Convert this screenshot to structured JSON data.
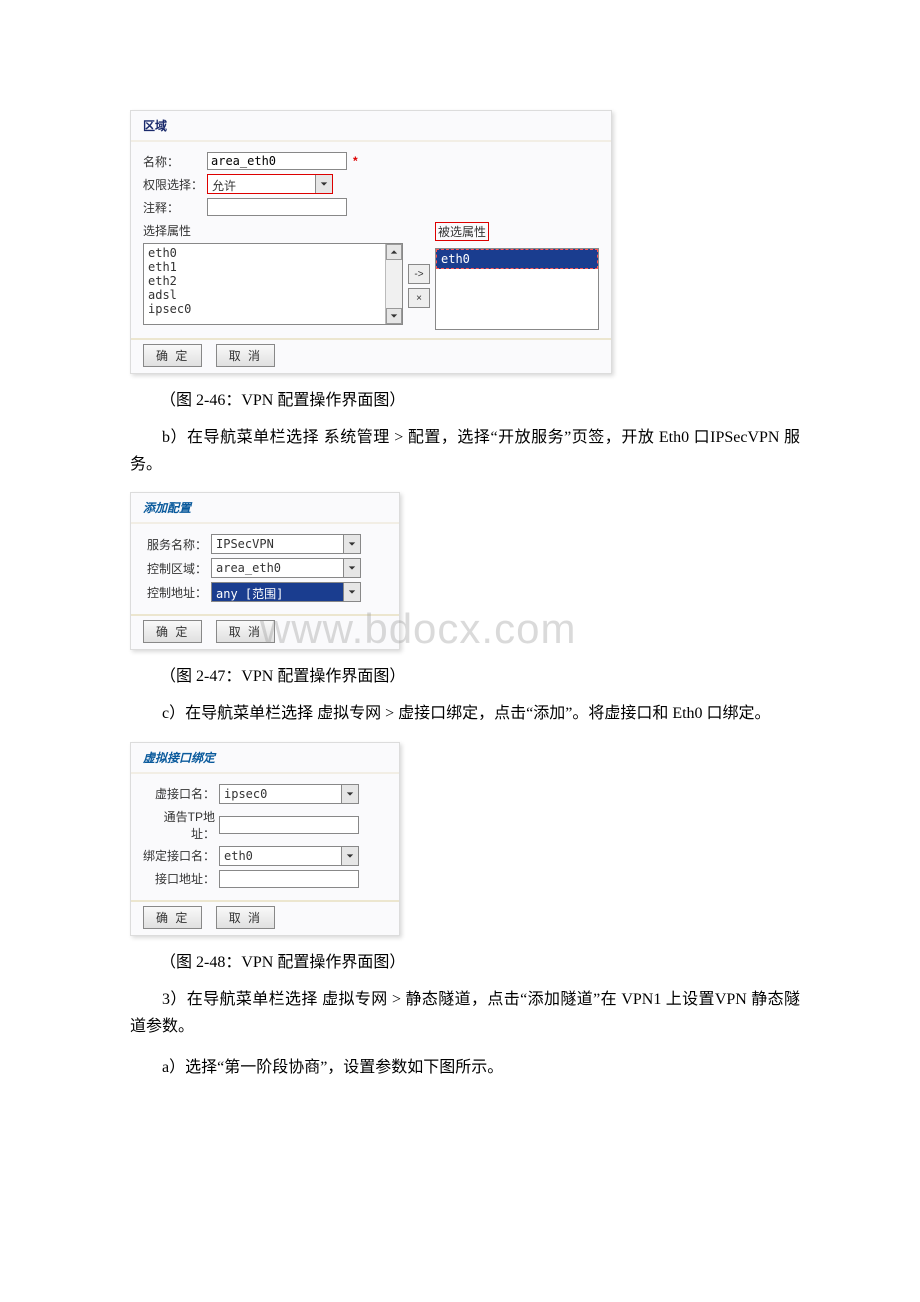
{
  "watermark": "www.bdocx.com",
  "panel1": {
    "title": "区域",
    "labels": {
      "name": "名称：",
      "perm": "权限选择：",
      "comment": "注释：",
      "selectAttr": "选择属性",
      "selectedAttr": "被选属性"
    },
    "values": {
      "name": "area_eth0",
      "perm": "允许"
    },
    "attrs": [
      "eth0",
      "eth1",
      "eth2",
      "adsl",
      "ipsec0"
    ],
    "selected": [
      "eth0"
    ],
    "buttons": {
      "ok": "确 定",
      "cancel": "取 消"
    },
    "transfer": {
      "add": "->",
      "remove": "×"
    }
  },
  "caption1": "（图 2-46：VPN 配置操作界面图）",
  "para_b": "b）在导航菜单栏选择 系统管理 > 配置，选择“开放服务”页签，开放 Eth0 口IPSecVPN 服务。",
  "panel2": {
    "title": "添加配置",
    "labels": {
      "svc": "服务名称：",
      "area": "控制区域：",
      "addr": "控制地址："
    },
    "values": {
      "svc": "IPSecVPN",
      "area": "area_eth0",
      "addr": "any [范围]"
    },
    "buttons": {
      "ok": "确 定",
      "cancel": "取 消"
    }
  },
  "caption2": "（图 2-47：VPN 配置操作界面图）",
  "para_c": "c）在导航菜单栏选择 虚拟专网 > 虚接口绑定，点击“添加”。将虚接口和 Eth0 口绑定。",
  "panel3": {
    "title": "虚拟接口绑定",
    "labels": {
      "vif": "虚接口名：",
      "tip": "通告TP地址：",
      "bif": "绑定接口名：",
      "ifaddr": "接口地址："
    },
    "values": {
      "vif": "ipsec0",
      "tip": "",
      "bif": "eth0",
      "ifaddr": ""
    },
    "buttons": {
      "ok": "确 定",
      "cancel": "取 消"
    }
  },
  "caption3": "（图 2-48：VPN 配置操作界面图）",
  "para_3": "3）在导航菜单栏选择 虚拟专网 > 静态隧道，点击“添加隧道”在 VPN1 上设置VPN 静态隧道参数。",
  "para_a": "a）选择“第一阶段协商”，设置参数如下图所示。"
}
